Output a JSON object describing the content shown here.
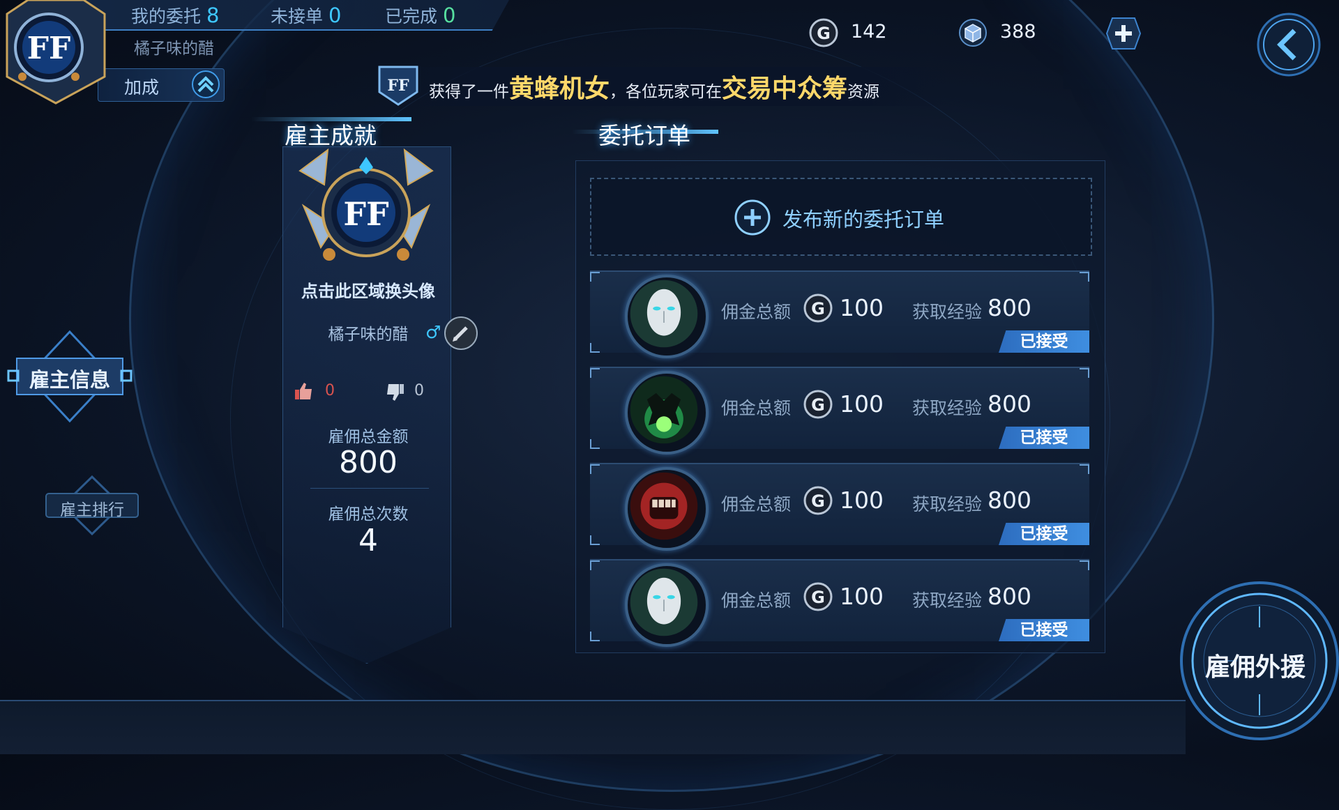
{
  "header": {
    "my_orders_label": "我的委托",
    "my_orders_count": "8",
    "unaccepted_label": "未接单",
    "unaccepted_count": "0",
    "completed_label": "已完成",
    "completed_count": "0",
    "player_name": "橘子味的醋",
    "bonus_label": "加成"
  },
  "currency": {
    "gold": "142",
    "gems": "388",
    "gold_icon": "gold-coin-icon",
    "gem_icon": "gem-cube-icon"
  },
  "announcement": {
    "prefix": "获得了一件",
    "item": "黄蜂机女",
    "middle": "，各位玩家可在",
    "place": "交易中众筹",
    "suffix": "资源"
  },
  "employer": {
    "section_title": "雇主成就",
    "avatar_hint": "点击此区域换头像",
    "name": "橘子味的醋",
    "gender_symbol": "♂",
    "likes": "0",
    "dislikes": "0",
    "total_amount_label": "雇佣总金额",
    "total_amount": "800",
    "total_count_label": "雇佣总次数",
    "total_count": "4"
  },
  "nav": {
    "employer_info": "雇主信息",
    "employer_rank": "雇主排行"
  },
  "orders": {
    "section_title": "委托订单",
    "publish_label": "发布新的委托订单",
    "items": [
      {
        "portrait": "white-mask-icon",
        "commission_label": "佣金总额",
        "commission": "100",
        "exp_label": "获取经验",
        "exp": "800",
        "status": "已接受"
      },
      {
        "portrait": "green-beast-icon",
        "commission_label": "佣金总额",
        "commission": "100",
        "exp_label": "获取经验",
        "exp": "800",
        "status": "已接受"
      },
      {
        "portrait": "red-fist-icon",
        "commission_label": "佣金总额",
        "commission": "100",
        "exp_label": "获取经验",
        "exp": "800",
        "status": "已接受"
      },
      {
        "portrait": "white-mask-icon",
        "commission_label": "佣金总额",
        "commission": "100",
        "exp_label": "获取经验",
        "exp": "800",
        "status": "已接受"
      }
    ]
  },
  "mercenary_button": "雇佣外援",
  "colors": {
    "accent_blue": "#3ec7ff",
    "highlight_gold": "#ffd86a",
    "badge_blue": "#3f8ee0"
  }
}
